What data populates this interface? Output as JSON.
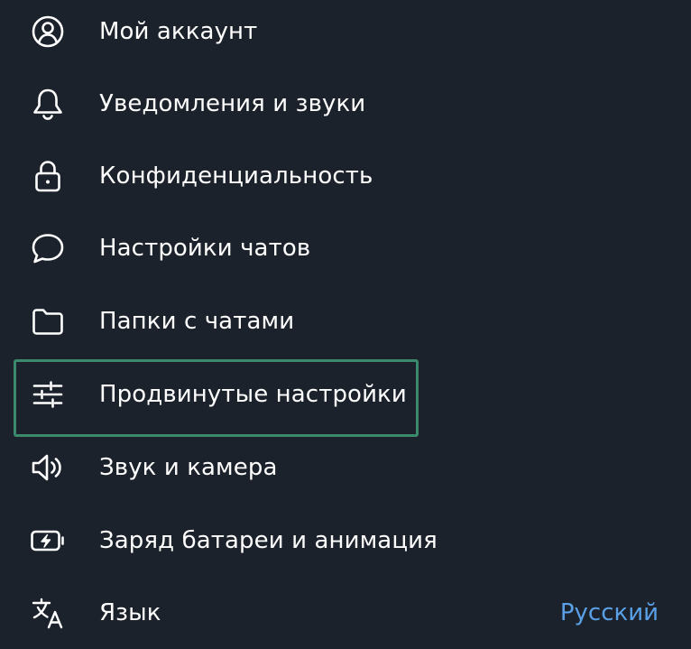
{
  "settings": {
    "items": [
      {
        "label": "Мой аккаунт",
        "icon": "account-icon"
      },
      {
        "label": "Уведомления и звуки",
        "icon": "bell-icon"
      },
      {
        "label": "Конфиденциальность",
        "icon": "lock-icon"
      },
      {
        "label": "Настройки чатов",
        "icon": "chat-bubble-icon"
      },
      {
        "label": "Папки с чатами",
        "icon": "folder-icon"
      },
      {
        "label": "Продвинутые настройки",
        "icon": "sliders-icon"
      },
      {
        "label": "Звук и камера",
        "icon": "speaker-icon"
      },
      {
        "label": "Заряд батареи и анимация",
        "icon": "battery-icon"
      },
      {
        "label": "Язык",
        "icon": "translate-icon",
        "value": "Русский"
      }
    ],
    "highlighted_index": 5
  },
  "colors": {
    "background": "#1c222b",
    "text": "#ffffff",
    "accent": "#5aa0e6",
    "highlight_border": "#3c8a6d"
  }
}
